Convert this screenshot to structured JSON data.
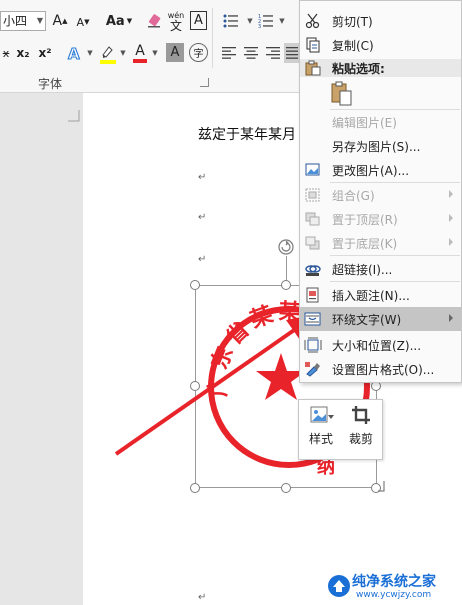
{
  "ribbon": {
    "font_size_value": "小四",
    "group_label": "字体",
    "row1": {
      "grow_font": "A",
      "shrink_font": "A",
      "change_case": "Aa",
      "phonetic_top": "wén",
      "phonetic_bottom": "文",
      "char_border": "A"
    },
    "row2": {
      "strike": "abc",
      "subscript": "x₂",
      "superscript": "x²",
      "font_color": "A",
      "char_shading": "A",
      "enclosed": "字"
    }
  },
  "document": {
    "text_line": "兹定于某年某月",
    "para_mark": "↵"
  },
  "stamp": {
    "top_text": "广东省某某",
    "bottom_text": "纳",
    "color": "#e8232a"
  },
  "context_menu": {
    "items": [
      {
        "label": "剪切(T)",
        "icon": "scissors-icon",
        "disabled": false
      },
      {
        "label": "复制(C)",
        "icon": "copy-icon",
        "disabled": false
      }
    ],
    "paste_header": "粘贴选项:",
    "items2": [
      {
        "label": "编辑图片(E)",
        "disabled": true
      },
      {
        "label": "另存为图片(S)...",
        "disabled": false
      },
      {
        "label": "更改图片(A)...",
        "disabled": false
      },
      {
        "label": "组合(G)",
        "disabled": true
      },
      {
        "label": "置于顶层(R)",
        "disabled": true
      },
      {
        "label": "置于底层(K)",
        "disabled": true
      },
      {
        "label": "超链接(I)...",
        "disabled": false
      },
      {
        "label": "插入题注(N)...",
        "disabled": false
      },
      {
        "label": "环绕文字(W)",
        "disabled": false
      },
      {
        "label": "大小和位置(Z)...",
        "disabled": false
      },
      {
        "label": "设置图片格式(O)...",
        "disabled": false
      }
    ]
  },
  "mini_toolbar": {
    "style_label": "样式",
    "crop_label": "裁剪"
  },
  "watermark": {
    "title": "纯净系统之家",
    "url": "www.ycwjzy.com"
  },
  "colors": {
    "accent_blue": "#2b579a",
    "arrow_red": "#e8232a",
    "highlight_yellow": "#ffff00"
  }
}
